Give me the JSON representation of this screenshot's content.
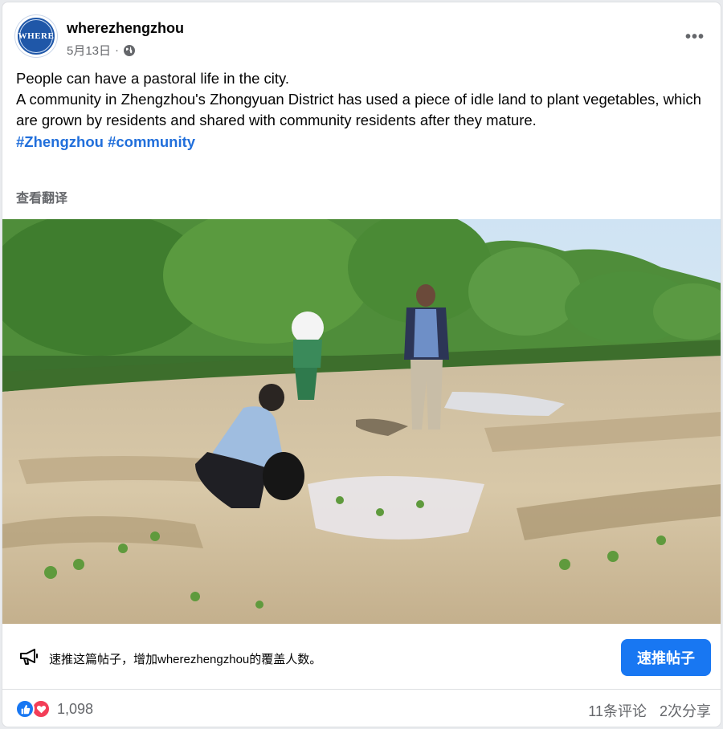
{
  "post": {
    "author": "wherezhengzhou",
    "avatar_text": "WHERE",
    "date": "5月13日",
    "separator": "·",
    "audience_icon": "globe-icon",
    "more_icon": "more-options-icon",
    "more_glyph": "•••",
    "text_lines": [
      "People can have a pastoral life in the city.",
      "A community in Zhengzhou's Zhongyuan District has used a piece of idle land to plant vegetables, which are grown by residents and shared with community residents after they mature."
    ],
    "hashtags": [
      "#Zhengzhou",
      "#community"
    ],
    "translate_label": "查看翻译"
  },
  "boost": {
    "icon": "megaphone-icon",
    "text": "速推这篇帖子，增加wherezhengzhou的覆盖人数。",
    "button_label": "速推帖子"
  },
  "engagement": {
    "reaction_icons": [
      "like-icon",
      "love-icon"
    ],
    "reaction_count": "1,098",
    "comments": "11条评论",
    "shares": "2次分享"
  },
  "colors": {
    "accent": "#1877f2",
    "hashtag": "#216fdb",
    "secondary_text": "#65676b",
    "love": "#f33e58"
  }
}
